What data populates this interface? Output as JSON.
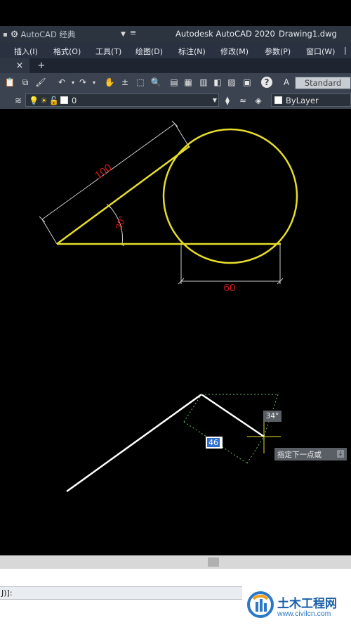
{
  "titlebar": {
    "workspace_label": "AutoCAD 经典",
    "app_title": "Autodesk AutoCAD 2020",
    "file_name": "Drawing1.dwg"
  },
  "menubar": {
    "items": [
      "插入(I)",
      "格式(O)",
      "工具(T)",
      "绘图(D)",
      "标注(N)",
      "修改(M)",
      "参数(P)",
      "窗口(W)"
    ]
  },
  "tabs": {
    "close_glyph": "×",
    "new_glyph": "+"
  },
  "toolbar": {
    "text_style": "Standard",
    "layer_name": "0",
    "linetype": "ByLayer"
  },
  "drawing": {
    "dim_length_1": "100",
    "dim_angle": "30°",
    "dim_length_2": "60"
  },
  "dynamic_input": {
    "angle_value": "34°",
    "length_value": "46",
    "prompt": "指定下一点或",
    "prompt_icon": "↓"
  },
  "command_line": {
    "text": "J)]:"
  },
  "watermark": {
    "brand_text": "土木工程网",
    "url": "www.civilcn.com"
  },
  "colors": {
    "yellow_geometry": "#e6dd2a",
    "dimension_text": "#d41a1a",
    "dimension_lines": "#cfcfcf"
  }
}
